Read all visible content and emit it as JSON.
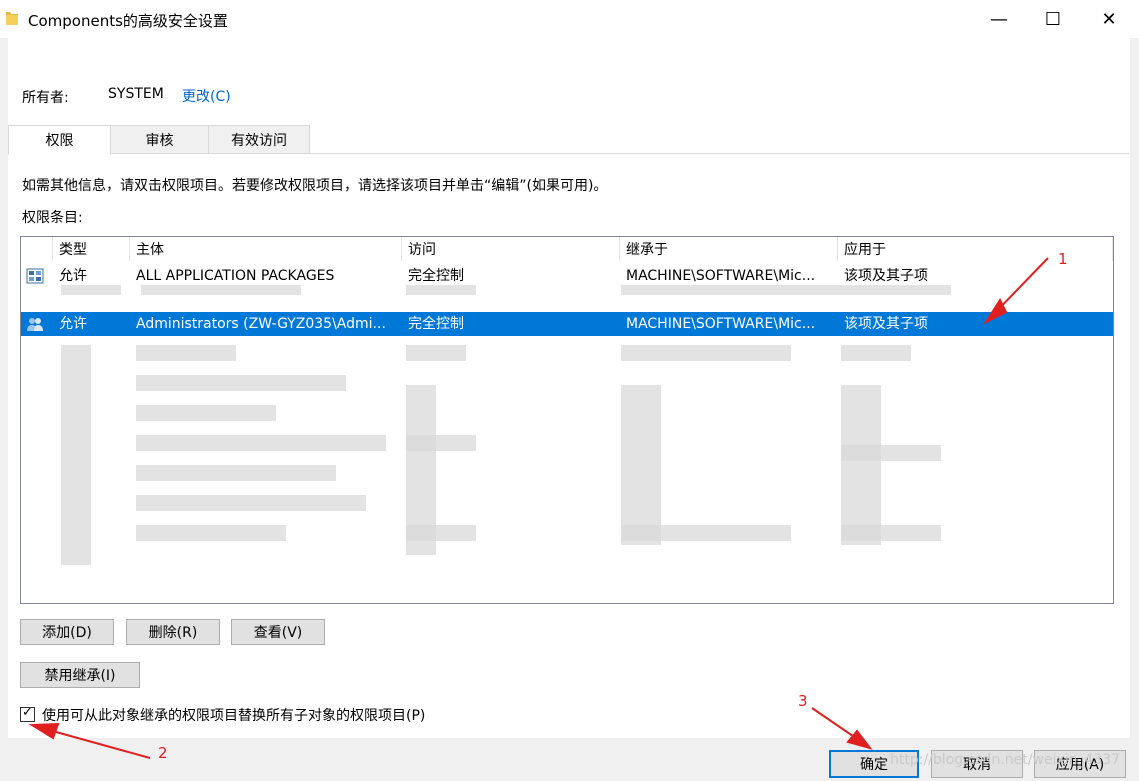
{
  "window": {
    "title": "Components的高级安全设置",
    "minimize": "—",
    "maximize": "☐",
    "close": "✕"
  },
  "owner": {
    "label": "所有者:",
    "value": "SYSTEM",
    "change": "更改(C)"
  },
  "tabs": [
    {
      "label": "权限"
    },
    {
      "label": "审核"
    },
    {
      "label": "有效访问"
    }
  ],
  "info_text": "如需其他信息，请双击权限项目。若要修改权限项目，请选择该项目并单击“编辑”(如果可用)。",
  "entries_label": "权限条目:",
  "columns": {
    "type": "类型",
    "principal": "主体",
    "access": "访问",
    "inherited": "继承于",
    "applies": "应用于"
  },
  "rows": [
    {
      "type": "允许",
      "principal": "ALL APPLICATION PACKAGES",
      "access": "完全控制",
      "inherited": "MACHINE\\SOFTWARE\\Mic...",
      "applies": "该项及其子项",
      "icon": "package-group-icon"
    },
    {
      "type": "允许",
      "principal": "Administrators (ZW-GYZ035\\Admi...",
      "access": "完全控制",
      "inherited": "MACHINE\\SOFTWARE\\Mic...",
      "applies": "该项及其子项",
      "icon": "users-icon"
    }
  ],
  "buttons": {
    "add": "添加(D)",
    "remove": "删除(R)",
    "view": "查看(V)",
    "disable_inherit": "禁用继承(I)",
    "ok": "确定",
    "cancel": "取消",
    "apply": "应用(A)"
  },
  "checkbox": {
    "label": "使用可从此对象继承的权限项目替换所有子对象的权限项目(P)",
    "checked": "✓"
  },
  "annotations": {
    "a1": "1",
    "a2": "2",
    "a3": "3"
  },
  "watermark": "http://blog.csdn.net/weixin_4337",
  "colors": {
    "selection": "#0078d7",
    "link": "#0066cc",
    "annotation": "#e02020"
  }
}
